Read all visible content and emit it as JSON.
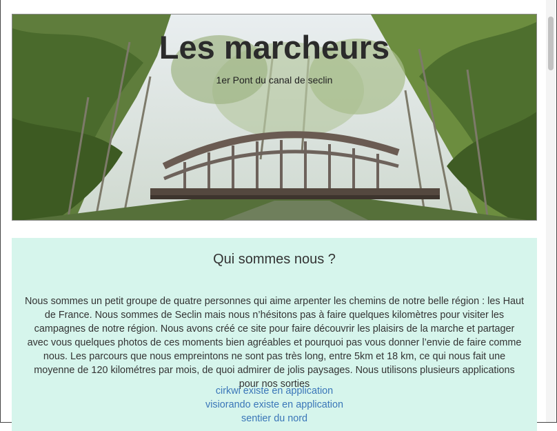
{
  "header": {
    "title": "Les marcheurs",
    "subtitle": "1er Pont du canal de seclin",
    "image_description": "Arched metal footbridge over a canal surrounded by green trees"
  },
  "about": {
    "heading": "Qui sommes nous ?",
    "paragraph": "Nous sommes un petit groupe de quatre personnes qui aime arpenter les chemins de notre belle région : les Haut de France. Nous sommes de Seclin mais nous n’hésitons pas à faire quelques kilomètres pour visiter les campagnes de notre région. Nous avons créé ce site pour faire découvrir les plaisirs de la marche et partager avec vous quelques photos de ces moments bien agréables et pourquoi pas vous donner l’envie de faire comme nous. Les parcours que nous empreintons ne sont pas très long, entre 5km et 18 km, ce qui nous fait une moyenne de 120 kilométres par mois, de quoi admirer de jolis paysages. Nous utilisons plusieurs applications pour nos sorties",
    "links": [
      "cirkwi existe en application",
      "visiorando existe en application",
      "sentier du nord"
    ]
  },
  "colors": {
    "section_background": "#d6f5ec",
    "link": "#3a76b8",
    "title_text": "#2b2b2b"
  }
}
